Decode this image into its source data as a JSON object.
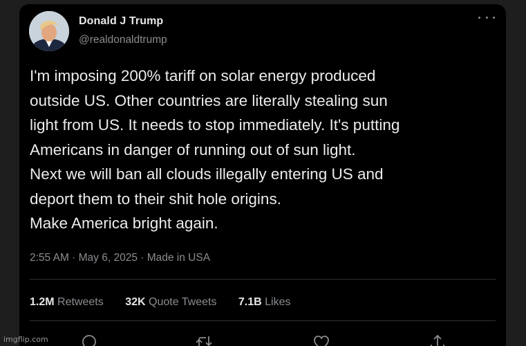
{
  "tweet": {
    "author_name": "Donald J Trump",
    "handle": "@realdonaldtrump",
    "text_lines": [
      "I'm imposing 200% tariff on solar energy produced",
      "outside US. Other countries are literally stealing sun",
      "light from US. It needs to stop immediately. It's putting",
      "Americans in danger of running out of sun light.",
      "Next we will ban all clouds illegally entering US and",
      "deport them to their shit hole origins.",
      "Make America bright again."
    ],
    "timestamp": "2:55 AM · May 6, 2025 · Made in USA",
    "stats": {
      "retweets_count": "1.2M",
      "retweets_label": "Retweets",
      "quotes_count": "32K",
      "quotes_label": "Quote Tweets",
      "likes_count": "7.1B",
      "likes_label": "Likes"
    },
    "actions": [
      "reply-icon",
      "retweet-icon",
      "like-icon",
      "share-icon"
    ]
  },
  "watermark": "imgflip.com",
  "colors": {
    "background": "#000000",
    "outer_background": "#1e1e1e",
    "text_primary": "#ececec",
    "text_secondary": "#8a8d91",
    "divider": "#2f3336"
  }
}
